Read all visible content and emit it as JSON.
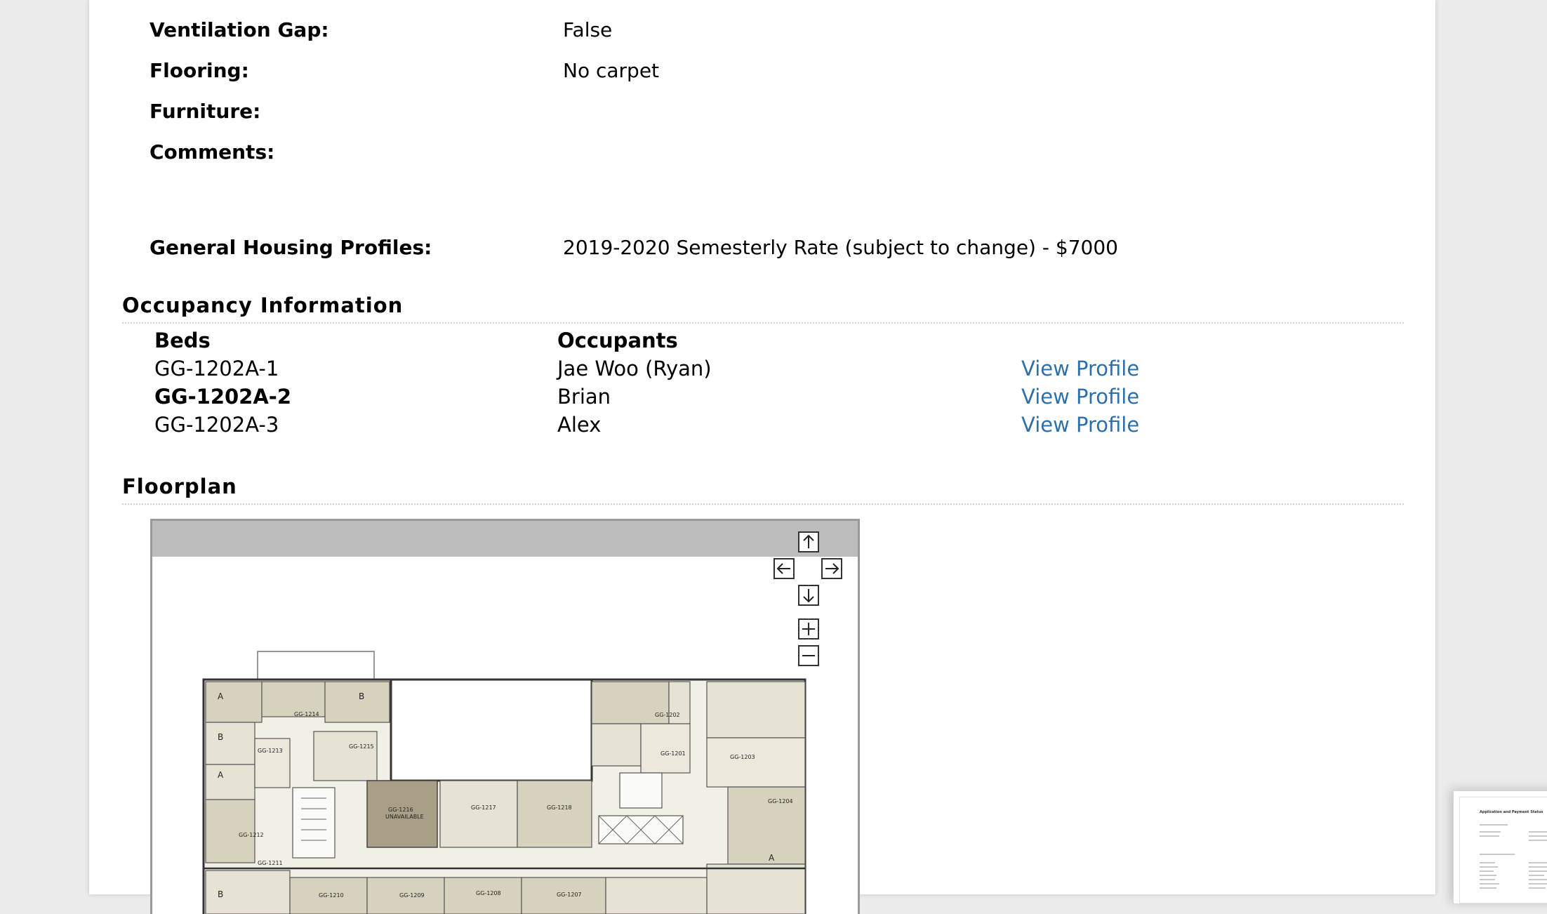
{
  "details": {
    "ventilation_gap": {
      "label": "Ventilation Gap:",
      "value": "False"
    },
    "flooring": {
      "label": "Flooring:",
      "value": "No carpet"
    },
    "furniture": {
      "label": "Furniture:",
      "value": ""
    },
    "comments": {
      "label": "Comments:",
      "value": ""
    },
    "general_housing_profiles": {
      "label": "General Housing Profiles:",
      "value": "2019-2020 Semesterly Rate (subject to change) - $7000"
    }
  },
  "occupancy": {
    "title": "Occupancy Information",
    "col_beds": "Beds",
    "col_occupants": "Occupants",
    "rows": [
      {
        "bed": "GG-1202A-1",
        "occupant": "Jae Woo (Ryan)",
        "link": "View Profile"
      },
      {
        "bed": "GG-1202A-2",
        "occupant": "Brian",
        "link": "View Profile"
      },
      {
        "bed": "GG-1202A-3",
        "occupant": "Alex",
        "link": "View Profile"
      }
    ]
  },
  "floorplan": {
    "title": "Floorplan",
    "rooms": {
      "r1214": "GG-1214",
      "r1213": "GG-1213",
      "r1215": "GG-1215",
      "r1212": "GG-1212",
      "r1211": "GG-1211",
      "r1216": "GG-1216",
      "r1216_status": "UNAVAILABLE",
      "r1217": "GG-1217",
      "r1218": "GG-1218",
      "r1202": "GG-1202",
      "r1201": "GG-1201",
      "r1203": "GG-1203",
      "r1204": "GG-1204",
      "r1210": "GG-1210",
      "r1209": "GG-1209",
      "r1208": "GG-1208",
      "r1207": "GG-1207"
    },
    "suite_letters": {
      "a": "A",
      "b": "B"
    },
    "controls": [
      "pan-up",
      "pan-left",
      "pan-right",
      "pan-down",
      "zoom-in",
      "zoom-out"
    ]
  },
  "thumbnail": {
    "title": "Application and Payment Status"
  },
  "colors": {
    "link": "#2d6fad",
    "room_fill": "#d6d2bd",
    "room_unavailable": "#a89f86",
    "wall": "#333333"
  }
}
